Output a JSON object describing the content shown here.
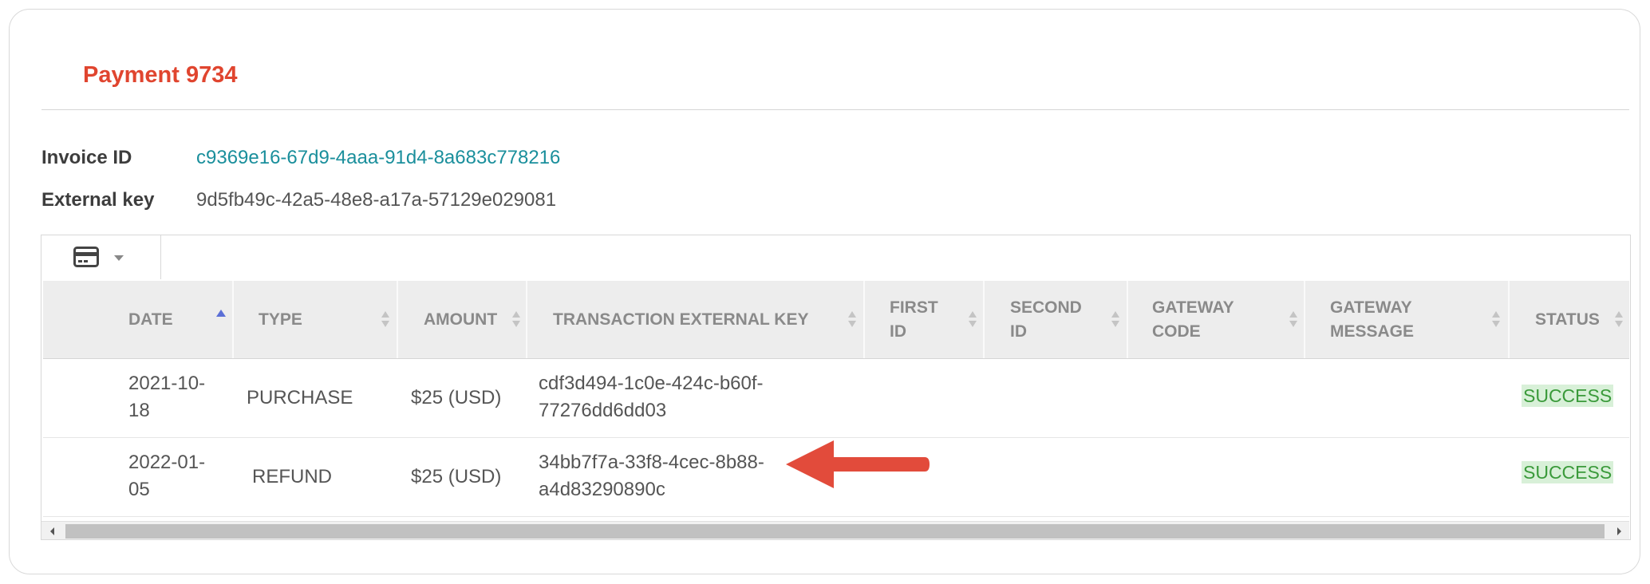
{
  "title": "Payment 9734",
  "info": {
    "invoice_label": "Invoice ID",
    "invoice_value": "c9369e16-67d9-4aaa-91d4-8a683c778216",
    "external_label": "External key",
    "external_value": "9d5fb49c-42a5-48e8-a17a-57129e029081"
  },
  "toolbar": {
    "icon": "credit-card-icon",
    "dropdown_icon": "caret-down-icon"
  },
  "columns": [
    {
      "label_1": "DATE",
      "label_2": "",
      "sort": "ascending"
    },
    {
      "label_1": "TYPE",
      "label_2": "",
      "sort": "none"
    },
    {
      "label_1": "AMOUNT",
      "label_2": "",
      "sort": "none"
    },
    {
      "label_1": "TRANSACTION EXTERNAL KEY",
      "label_2": "",
      "sort": "none"
    },
    {
      "label_1": "FIRST",
      "label_2": "ID",
      "sort": "none"
    },
    {
      "label_1": "SECOND",
      "label_2": "ID",
      "sort": "none"
    },
    {
      "label_1": "GATEWAY",
      "label_2": "CODE",
      "sort": "none"
    },
    {
      "label_1": "GATEWAY",
      "label_2": "MESSAGE",
      "sort": "none"
    },
    {
      "label_1": "STATUS",
      "label_2": "",
      "sort": "none"
    }
  ],
  "rows": [
    {
      "date_1": "2021-10-",
      "date_2": "18",
      "type": "PURCHASE",
      "amount": "$25 (USD)",
      "key_1": "cdf3d494-1c0e-424c-b60f-",
      "key_2": "77276dd6dd03",
      "first_id": "",
      "second_id": "",
      "gateway_code": "",
      "gateway_message": "",
      "status": "SUCCESS"
    },
    {
      "date_1": "2022-01-",
      "date_2": "05",
      "type": "REFUND",
      "amount": "$25 (USD)",
      "key_1": "34bb7f7a-33f8-4cec-8b88-",
      "key_2": "a4d83290890c",
      "first_id": "",
      "second_id": "",
      "gateway_code": "",
      "gateway_message": "",
      "status": "SUCCESS"
    }
  ],
  "colors": {
    "title": "#e0452f",
    "link": "#1a8f9c",
    "status_text": "#3a9a3a",
    "status_bg": "#d8f0d8",
    "annotation_arrow": "#e24b3b"
  },
  "annotation": {
    "icon": "red-arrow-icon",
    "points_to": "rows.1"
  }
}
